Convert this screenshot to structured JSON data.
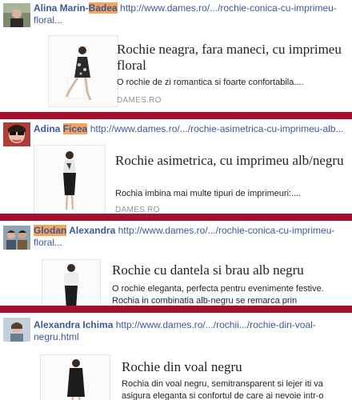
{
  "feed": {
    "posts": [
      {
        "first": "Alina Marin-",
        "hl": "Badea",
        "last": "",
        "url": "http://www.dames.ro/.../rochie-conica-cu-imprimeu-floral...",
        "title": "Rochie neagra, fara maneci, cu imprimeu floral",
        "desc": "O rochie de zi romantica si foarte confortabila....",
        "source": "DAMES.RO"
      },
      {
        "first": "Adina ",
        "hl": "Ficea",
        "last": "",
        "url": "http://www.dames.ro/.../rochie-asimetrica-cu-imprimeu-alb...",
        "title": "Rochie asimetrica, cu imprimeu alb/negru",
        "desc": "Rochia imbina mai multe tipuri de imprimeuri:....",
        "source": "DAMES.RO"
      },
      {
        "first": "",
        "hl": "Glodan",
        "last": " Alexandra",
        "url": "http://www.dames.ro/.../rochie-conica-cu-imprimeu-floral...",
        "title": "Rochie cu dantela si brau alb negru",
        "desc": "O rochie eleganta, perfecta pentru evenimente festive. Rochia in combinatia alb-negru se remarca prin",
        "source": ""
      },
      {
        "first": "Alexandra Ichima",
        "hl": "",
        "last": "",
        "url": "http://www.dames.ro/.../rochii.../rochie-din-voal-negru.html",
        "title": "Rochie din voal negru",
        "desc": "Rochia din voal negru, semitransparent si lejer iti va asigura eleganta si confortul de care ai nevoie intr-o",
        "source": ""
      }
    ]
  }
}
